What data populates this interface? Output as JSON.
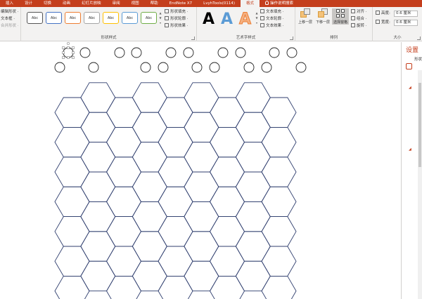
{
  "tabs": [
    "插入",
    "设计",
    "切换",
    "动画",
    "幻灯片放映",
    "审阅",
    "视图",
    "帮助",
    "EndNote X7",
    "LvyhTools(0114)",
    "格式",
    "操作说明搜索"
  ],
  "active_tab": "格式",
  "ribbon": {
    "insert_shapes": {
      "edit_shape": "编辑形状 ·",
      "text_box": "文本框 ·",
      "merge_shapes": "合并形状 ·"
    },
    "shape_styles": {
      "label": "形状样式",
      "swatches": [
        "Abc",
        "Abc",
        "Abc",
        "Abc",
        "Abc",
        "Abc",
        "Abc"
      ],
      "fill": "形状填充 ·",
      "outline": "形状轮廓 ·",
      "effects": "形状效果 ·"
    },
    "wordart_styles": {
      "label": "艺术字样式",
      "letters": [
        "A",
        "A",
        "A"
      ],
      "text_fill": "文本填充 ·",
      "text_outline": "文本轮廓 ·",
      "text_effects": "文本效果 ·"
    },
    "arrange": {
      "label": "排列",
      "bring_forward": "上移一层",
      "send_backward": "下移一层",
      "selection_pane": "选择窗格",
      "align": "对齐 ·",
      "group": "组合 ·",
      "rotate": "旋转 ·"
    },
    "size": {
      "label": "大小",
      "height_label": "高度:",
      "height_value": "0.6 厘米",
      "width_label": "宽度:",
      "width_value": "0.6 厘米"
    }
  },
  "pane": {
    "title": "设置",
    "subtitle": "形状"
  },
  "colors": {
    "accent": "#c43e1c",
    "hexagon_stroke": "#2f3e6e",
    "circle_stroke": "#222222"
  }
}
